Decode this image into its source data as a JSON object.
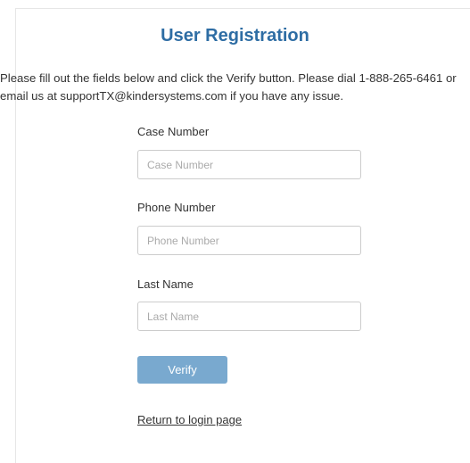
{
  "page": {
    "title": "User Registration",
    "intro": "Please fill out the fields below and click the Verify button. Please dial 1-888-265-6461 or email us at supportTX@kindersystems.com if you have any issue."
  },
  "form": {
    "case_number": {
      "label": "Case Number",
      "placeholder": "Case Number",
      "value": ""
    },
    "phone_number": {
      "label": "Phone Number",
      "placeholder": "Phone Number",
      "value": ""
    },
    "last_name": {
      "label": "Last Name",
      "placeholder": "Last Name",
      "value": ""
    },
    "verify_label": "Verify",
    "return_link": "Return to login page"
  },
  "colors": {
    "title": "#2e6da4",
    "button": "#79a9cf",
    "input_border": "#cccccc"
  }
}
